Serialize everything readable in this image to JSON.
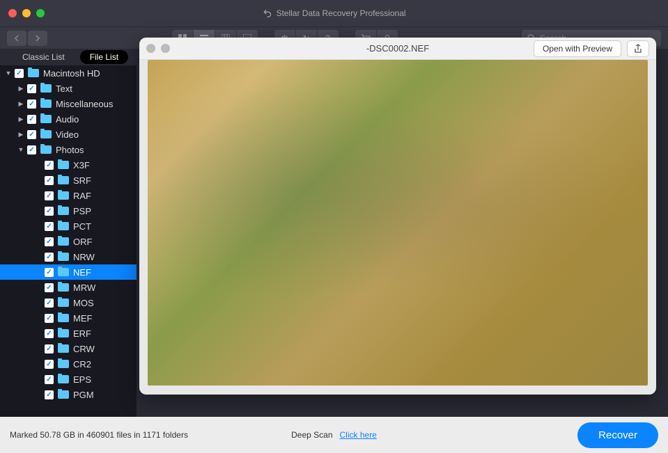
{
  "app": {
    "title": "Stellar Data Recovery Professional"
  },
  "search": {
    "placeholder": "Search"
  },
  "tabs": {
    "classic": "Classic List",
    "file": "File List"
  },
  "tree": {
    "root": "Macintosh HD",
    "folders": [
      "Text",
      "Miscellaneous",
      "Audio",
      "Video",
      "Photos"
    ],
    "photos_children": [
      "X3F",
      "SRF",
      "RAF",
      "PSP",
      "PCT",
      "ORF",
      "NRW",
      "NEF",
      "MRW",
      "MOS",
      "MEF",
      "ERF",
      "CRW",
      "CR2",
      "EPS",
      "PGM"
    ],
    "selected": "NEF"
  },
  "preview": {
    "filename": "-DSC0002.NEF",
    "open_label": "Open with Preview"
  },
  "status": {
    "text": "Marked 50.78 GB in 460901 files in 1171 folders",
    "deep_scan_label": "Deep Scan",
    "deep_scan_link": "Click here",
    "recover_label": "Recover"
  }
}
